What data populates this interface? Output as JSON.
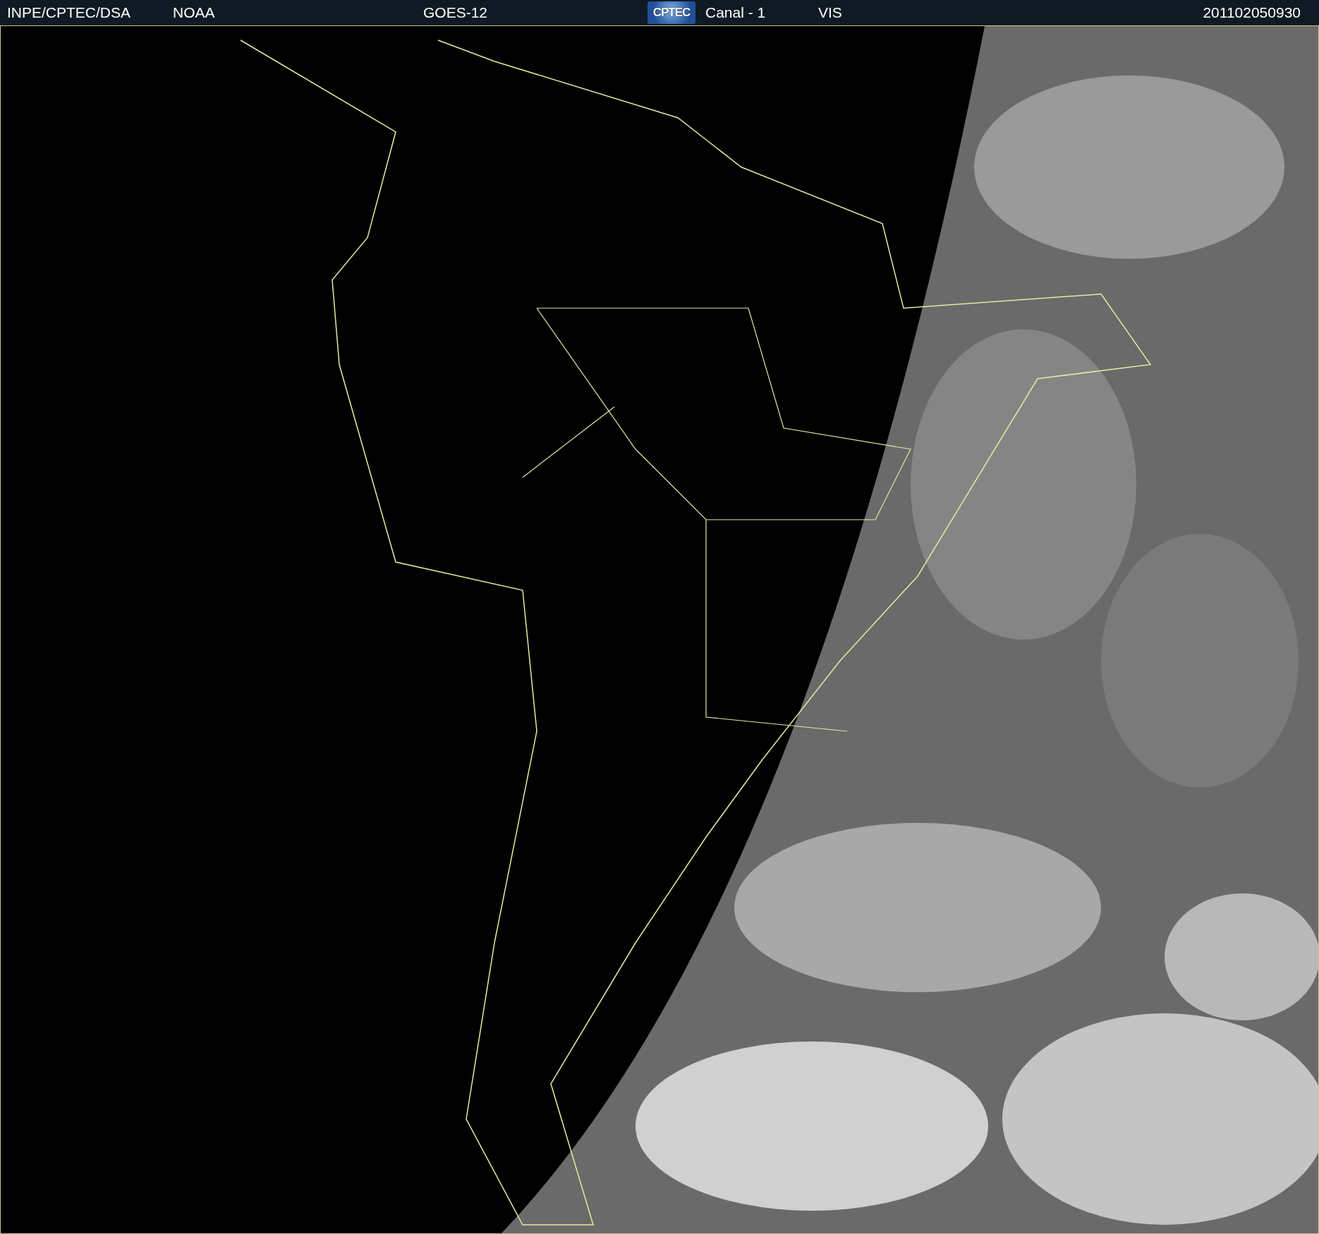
{
  "header": {
    "source": "INPE/CPTEC/DSA",
    "agency": "NOAA",
    "satellite": "GOES-12",
    "logo": "CPTEC",
    "channel": "Canal - 1",
    "band": "VIS",
    "timestamp": "201102050930"
  }
}
